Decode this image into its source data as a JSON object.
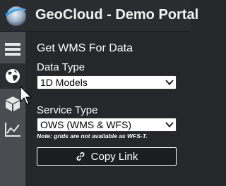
{
  "header": {
    "title": "GeoCloud - Demo Portal",
    "logo_icon": "globe-logo-icon"
  },
  "sidebar": {
    "items": [
      {
        "name": "menu",
        "icon": "hamburger-icon",
        "active": false
      },
      {
        "name": "globe",
        "icon": "globe-icon",
        "active": true
      },
      {
        "name": "cube",
        "icon": "cube-icon",
        "active": false
      },
      {
        "name": "chart",
        "icon": "line-chart-icon",
        "active": false
      }
    ]
  },
  "panel": {
    "title": "Get WMS For Data",
    "data_type": {
      "label": "Data Type",
      "selected": "1D Models"
    },
    "service_type": {
      "label": "Service Type",
      "selected": "OWS (WMS & WFS)",
      "note": "Note: grids are not available as WFS-T."
    },
    "copy_link": {
      "label": "Copy Link",
      "icon": "link-icon"
    }
  },
  "colors": {
    "background": "#25272b",
    "sidebar": "#4a4c52",
    "text": "#ffffff"
  }
}
